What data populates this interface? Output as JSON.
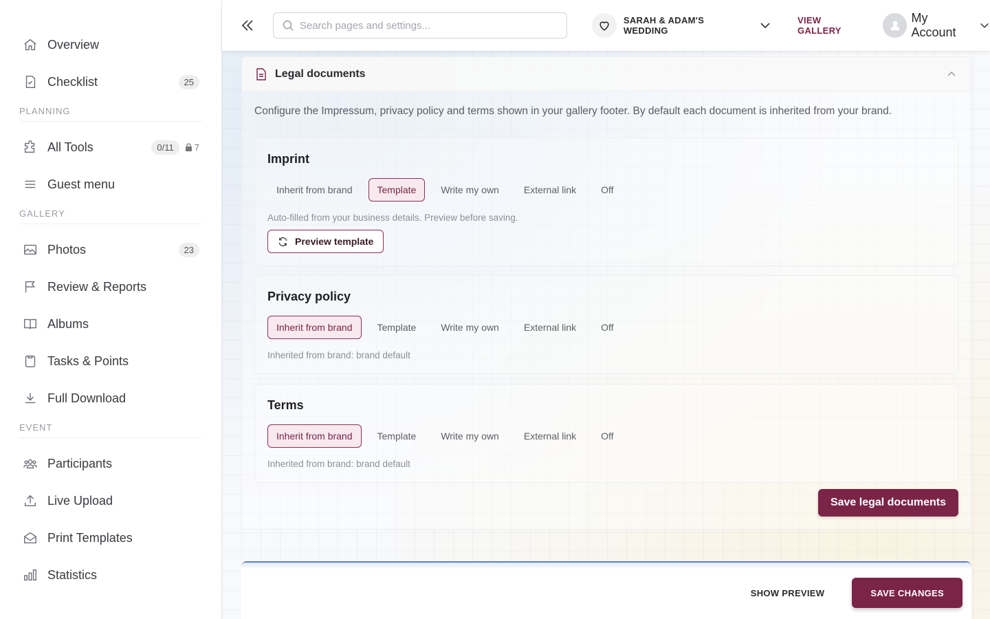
{
  "sidebar": {
    "top_items": [
      {
        "label": "Overview",
        "icon": "home-icon"
      },
      {
        "label": "Checklist",
        "icon": "checklist-icon",
        "badge": "25"
      }
    ],
    "sections": [
      {
        "title": "PLANNING",
        "items": [
          {
            "label": "All Tools",
            "icon": "puzzle-icon",
            "badge": "0/11",
            "locked_count": "7"
          },
          {
            "label": "Guest menu",
            "icon": "menu-icon"
          }
        ]
      },
      {
        "title": "GALLERY",
        "items": [
          {
            "label": "Photos",
            "icon": "image-icon",
            "badge": "23"
          },
          {
            "label": "Review & Reports",
            "icon": "flag-icon"
          },
          {
            "label": "Albums",
            "icon": "book-icon"
          },
          {
            "label": "Tasks & Points",
            "icon": "clipboard-icon"
          },
          {
            "label": "Full Download",
            "icon": "download-icon"
          }
        ]
      },
      {
        "title": "EVENT",
        "items": [
          {
            "label": "Participants",
            "icon": "users-icon"
          },
          {
            "label": "Live Upload",
            "icon": "upload-icon"
          },
          {
            "label": "Print Templates",
            "icon": "envelope-icon"
          },
          {
            "label": "Statistics",
            "icon": "bar-chart-icon"
          }
        ]
      }
    ]
  },
  "topbar": {
    "search_placeholder": "Search pages and settings...",
    "event_name": "SARAH & ADAM'S WEDDING",
    "view_gallery": "VIEW GALLERY",
    "account_name": "My Account"
  },
  "legal": {
    "title": "Legal documents",
    "description": "Configure the Impressum, privacy policy and terms shown in your gallery footer. By default each document is inherited from your brand.",
    "tab_labels": [
      "Inherit from brand",
      "Template",
      "Write my own",
      "External link",
      "Off"
    ],
    "documents": [
      {
        "title": "Imprint",
        "active_tab": 1,
        "hint": "Auto-filled from your business details. Preview before saving.",
        "button": "Preview template"
      },
      {
        "title": "Privacy policy",
        "active_tab": 0,
        "hint": "Inherited from brand: brand default"
      },
      {
        "title": "Terms",
        "active_tab": 0,
        "hint": "Inherited from brand: brand default"
      }
    ],
    "save_label": "Save legal documents"
  },
  "bottom_bar": {
    "show_preview": "SHOW PREVIEW",
    "save_changes": "SAVE CHANGES"
  },
  "colors": {
    "accent": "#7a2447",
    "accent_light": "#f7e9ee"
  }
}
